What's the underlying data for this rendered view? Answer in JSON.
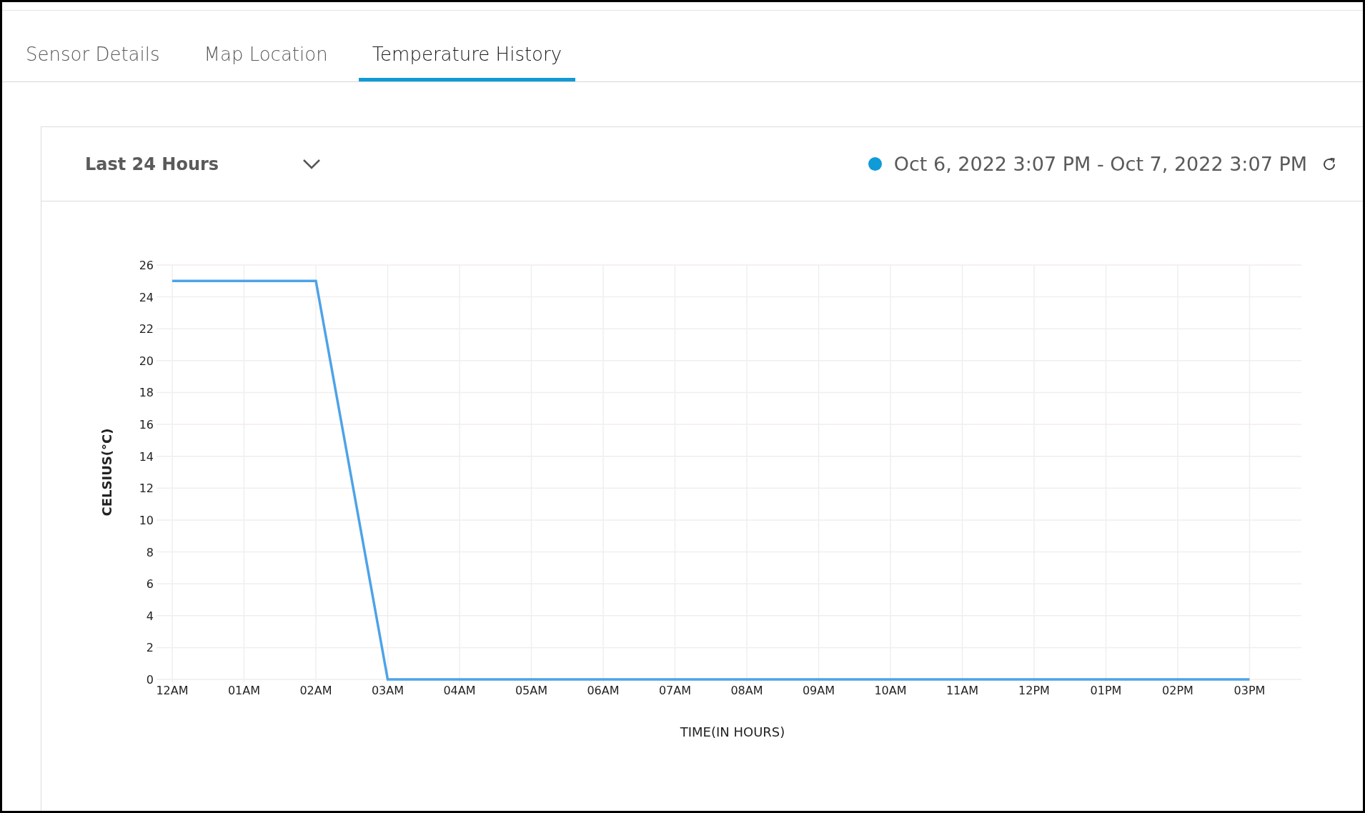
{
  "tabs": [
    {
      "label": "Sensor Details",
      "selected": false
    },
    {
      "label": "Map Location",
      "selected": false
    },
    {
      "label": "Temperature History",
      "selected": true
    }
  ],
  "panel": {
    "range_select": {
      "value": "Last 24 Hours"
    },
    "date_range": "Oct 6, 2022 3:07 PM - Oct 7, 2022 3:07 PM",
    "chart_data": {
      "type": "line",
      "xlabel": "TIME(IN HOURS)",
      "ylabel": "CELSIUS(°C)",
      "categories": [
        "12AM",
        "01AM",
        "02AM",
        "03AM",
        "04AM",
        "05AM",
        "06AM",
        "07AM",
        "08AM",
        "09AM",
        "10AM",
        "11AM",
        "12PM",
        "01PM",
        "02PM",
        "03PM"
      ],
      "series": [
        {
          "color": "#4da3e8",
          "values": [
            25,
            25,
            25,
            0,
            0,
            0,
            0,
            0,
            0,
            0,
            0,
            0,
            0,
            0,
            0,
            0
          ]
        }
      ],
      "ylim": [
        0,
        26
      ],
      "grid": true,
      "yticks": [
        0,
        2,
        4,
        6,
        8,
        10,
        12,
        14,
        16,
        18,
        20,
        22,
        24,
        26
      ]
    }
  }
}
